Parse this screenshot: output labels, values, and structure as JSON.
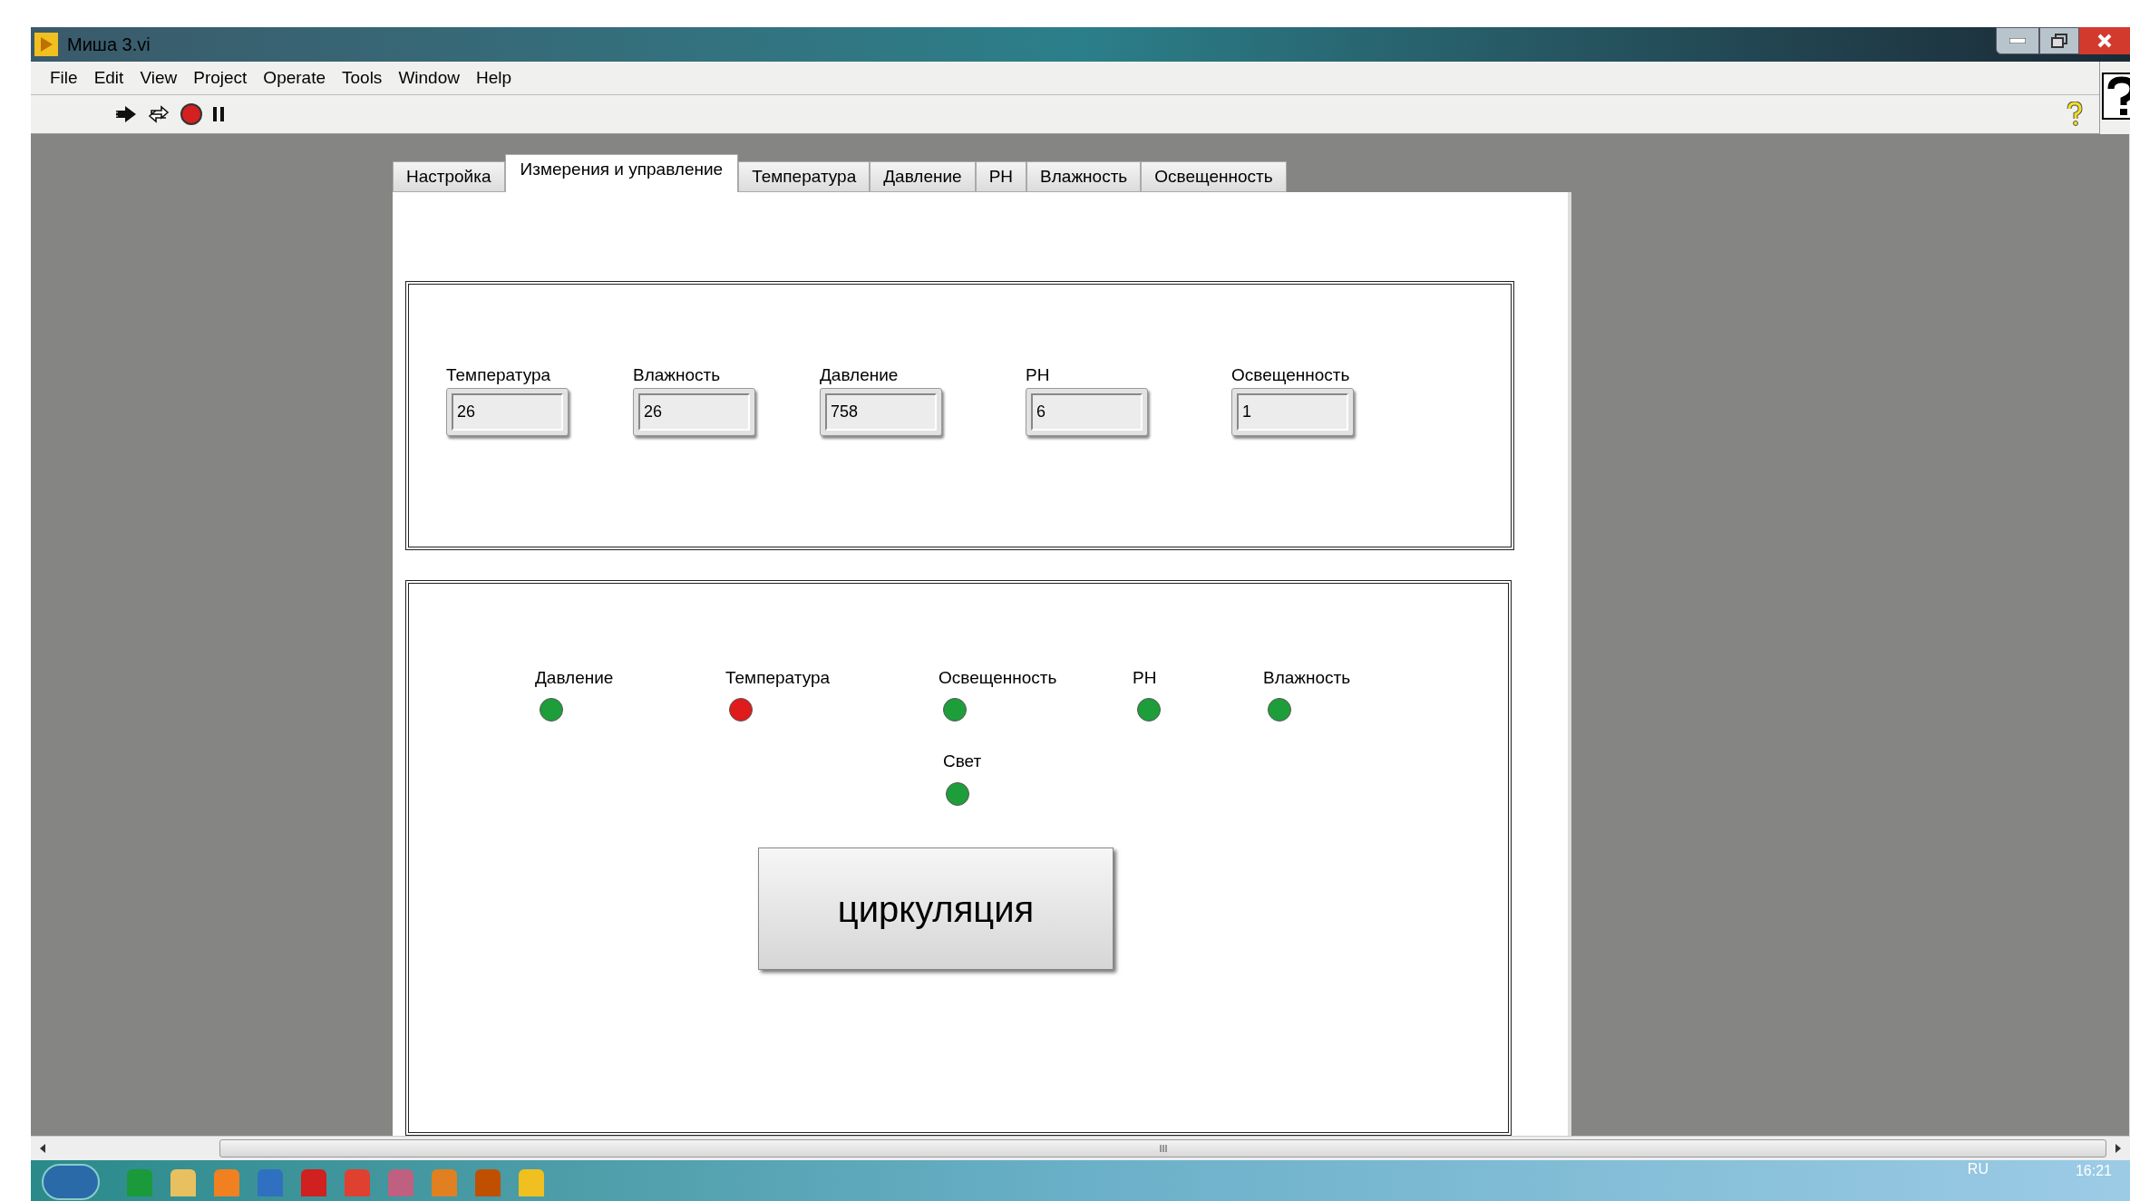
{
  "window": {
    "title": "Миша 3.vi"
  },
  "menu": [
    "File",
    "Edit",
    "View",
    "Project",
    "Operate",
    "Tools",
    "Window",
    "Help"
  ],
  "tabs": [
    {
      "label": "Настройка",
      "selected": false
    },
    {
      "label": "Измерения и управление",
      "selected": true
    },
    {
      "label": "Температура",
      "selected": false
    },
    {
      "label": "Давление",
      "selected": false
    },
    {
      "label": "PH",
      "selected": false
    },
    {
      "label": "Влажность",
      "selected": false
    },
    {
      "label": "Освещенность",
      "selected": false
    }
  ],
  "measurements": [
    {
      "label": "Температура",
      "value": "26"
    },
    {
      "label": "Влажность",
      "value": "26"
    },
    {
      "label": "Давление",
      "value": "758"
    },
    {
      "label": "PH",
      "value": "6"
    },
    {
      "label": "Освещенность",
      "value": "1"
    }
  ],
  "indicators": [
    {
      "label": "Давление",
      "color": "#1e9e3a"
    },
    {
      "label": "Температура",
      "color": "#e01b1b"
    },
    {
      "label": "Освещенность",
      "color": "#1e9e3a"
    },
    {
      "label": "PH",
      "color": "#1e9e3a"
    },
    {
      "label": "Влажность",
      "color": "#1e9e3a"
    },
    {
      "label": "Свет",
      "color": "#1e9e3a"
    }
  ],
  "button": {
    "label": "циркуляция"
  },
  "taskbar": {
    "language": "RU",
    "clock": "16:21"
  }
}
